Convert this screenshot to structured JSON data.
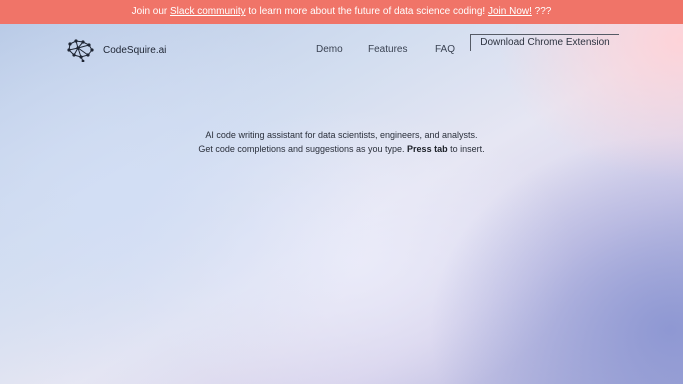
{
  "banner": {
    "prefix": "Join our ",
    "link": "Slack community",
    "middle": " to learn more about the future of data science coding! ",
    "join_link": "Join Now!",
    "suffix": " ???"
  },
  "nav": {
    "logo_text": "CodeSquire.ai",
    "links": [
      "Demo",
      "Features",
      "FAQ"
    ],
    "cta_label": "Download Chrome Extension"
  },
  "hero": {
    "line1": "AI code writing assistant for data scientists, engineers, and analysts.",
    "line2_prefix": "Get code completions and suggestions as you type. ",
    "line2_bold": "Press tab",
    "line2_suffix": " to insert."
  },
  "colors": {
    "banner_bg": "#f07468",
    "text_dark": "#1e2533"
  }
}
